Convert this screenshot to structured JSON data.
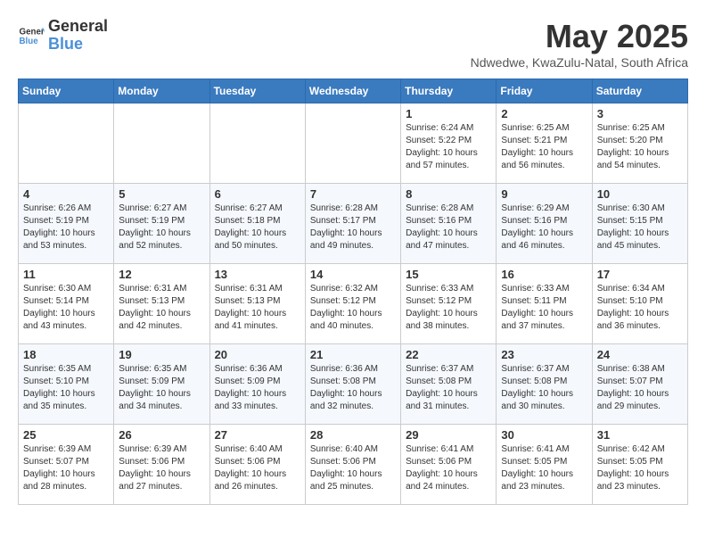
{
  "header": {
    "logo_line1": "General",
    "logo_line2": "Blue",
    "month_title": "May 2025",
    "location": "Ndwedwe, KwaZulu-Natal, South Africa"
  },
  "weekdays": [
    "Sunday",
    "Monday",
    "Tuesday",
    "Wednesday",
    "Thursday",
    "Friday",
    "Saturday"
  ],
  "weeks": [
    [
      {
        "day": "",
        "info": ""
      },
      {
        "day": "",
        "info": ""
      },
      {
        "day": "",
        "info": ""
      },
      {
        "day": "",
        "info": ""
      },
      {
        "day": "1",
        "info": "Sunrise: 6:24 AM\nSunset: 5:22 PM\nDaylight: 10 hours\nand 57 minutes."
      },
      {
        "day": "2",
        "info": "Sunrise: 6:25 AM\nSunset: 5:21 PM\nDaylight: 10 hours\nand 56 minutes."
      },
      {
        "day": "3",
        "info": "Sunrise: 6:25 AM\nSunset: 5:20 PM\nDaylight: 10 hours\nand 54 minutes."
      }
    ],
    [
      {
        "day": "4",
        "info": "Sunrise: 6:26 AM\nSunset: 5:19 PM\nDaylight: 10 hours\nand 53 minutes."
      },
      {
        "day": "5",
        "info": "Sunrise: 6:27 AM\nSunset: 5:19 PM\nDaylight: 10 hours\nand 52 minutes."
      },
      {
        "day": "6",
        "info": "Sunrise: 6:27 AM\nSunset: 5:18 PM\nDaylight: 10 hours\nand 50 minutes."
      },
      {
        "day": "7",
        "info": "Sunrise: 6:28 AM\nSunset: 5:17 PM\nDaylight: 10 hours\nand 49 minutes."
      },
      {
        "day": "8",
        "info": "Sunrise: 6:28 AM\nSunset: 5:16 PM\nDaylight: 10 hours\nand 47 minutes."
      },
      {
        "day": "9",
        "info": "Sunrise: 6:29 AM\nSunset: 5:16 PM\nDaylight: 10 hours\nand 46 minutes."
      },
      {
        "day": "10",
        "info": "Sunrise: 6:30 AM\nSunset: 5:15 PM\nDaylight: 10 hours\nand 45 minutes."
      }
    ],
    [
      {
        "day": "11",
        "info": "Sunrise: 6:30 AM\nSunset: 5:14 PM\nDaylight: 10 hours\nand 43 minutes."
      },
      {
        "day": "12",
        "info": "Sunrise: 6:31 AM\nSunset: 5:13 PM\nDaylight: 10 hours\nand 42 minutes."
      },
      {
        "day": "13",
        "info": "Sunrise: 6:31 AM\nSunset: 5:13 PM\nDaylight: 10 hours\nand 41 minutes."
      },
      {
        "day": "14",
        "info": "Sunrise: 6:32 AM\nSunset: 5:12 PM\nDaylight: 10 hours\nand 40 minutes."
      },
      {
        "day": "15",
        "info": "Sunrise: 6:33 AM\nSunset: 5:12 PM\nDaylight: 10 hours\nand 38 minutes."
      },
      {
        "day": "16",
        "info": "Sunrise: 6:33 AM\nSunset: 5:11 PM\nDaylight: 10 hours\nand 37 minutes."
      },
      {
        "day": "17",
        "info": "Sunrise: 6:34 AM\nSunset: 5:10 PM\nDaylight: 10 hours\nand 36 minutes."
      }
    ],
    [
      {
        "day": "18",
        "info": "Sunrise: 6:35 AM\nSunset: 5:10 PM\nDaylight: 10 hours\nand 35 minutes."
      },
      {
        "day": "19",
        "info": "Sunrise: 6:35 AM\nSunset: 5:09 PM\nDaylight: 10 hours\nand 34 minutes."
      },
      {
        "day": "20",
        "info": "Sunrise: 6:36 AM\nSunset: 5:09 PM\nDaylight: 10 hours\nand 33 minutes."
      },
      {
        "day": "21",
        "info": "Sunrise: 6:36 AM\nSunset: 5:08 PM\nDaylight: 10 hours\nand 32 minutes."
      },
      {
        "day": "22",
        "info": "Sunrise: 6:37 AM\nSunset: 5:08 PM\nDaylight: 10 hours\nand 31 minutes."
      },
      {
        "day": "23",
        "info": "Sunrise: 6:37 AM\nSunset: 5:08 PM\nDaylight: 10 hours\nand 30 minutes."
      },
      {
        "day": "24",
        "info": "Sunrise: 6:38 AM\nSunset: 5:07 PM\nDaylight: 10 hours\nand 29 minutes."
      }
    ],
    [
      {
        "day": "25",
        "info": "Sunrise: 6:39 AM\nSunset: 5:07 PM\nDaylight: 10 hours\nand 28 minutes."
      },
      {
        "day": "26",
        "info": "Sunrise: 6:39 AM\nSunset: 5:06 PM\nDaylight: 10 hours\nand 27 minutes."
      },
      {
        "day": "27",
        "info": "Sunrise: 6:40 AM\nSunset: 5:06 PM\nDaylight: 10 hours\nand 26 minutes."
      },
      {
        "day": "28",
        "info": "Sunrise: 6:40 AM\nSunset: 5:06 PM\nDaylight: 10 hours\nand 25 minutes."
      },
      {
        "day": "29",
        "info": "Sunrise: 6:41 AM\nSunset: 5:06 PM\nDaylight: 10 hours\nand 24 minutes."
      },
      {
        "day": "30",
        "info": "Sunrise: 6:41 AM\nSunset: 5:05 PM\nDaylight: 10 hours\nand 23 minutes."
      },
      {
        "day": "31",
        "info": "Sunrise: 6:42 AM\nSunset: 5:05 PM\nDaylight: 10 hours\nand 23 minutes."
      }
    ]
  ]
}
